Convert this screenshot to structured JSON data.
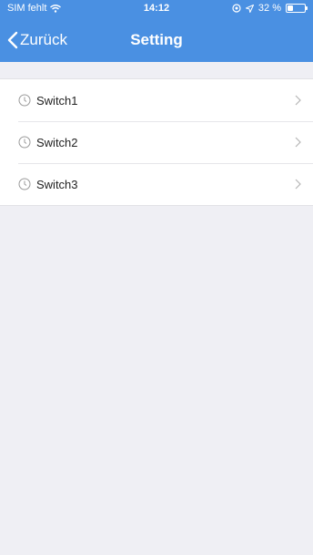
{
  "status_bar": {
    "carrier": "SIM fehlt",
    "time": "14:12",
    "battery": "32 %",
    "battery_level": 0.32
  },
  "nav": {
    "back_label": "Zurück",
    "title": "Setting"
  },
  "list": {
    "items": [
      {
        "label": "Switch1",
        "icon": "clock-icon"
      },
      {
        "label": "Switch2",
        "icon": "clock-icon"
      },
      {
        "label": "Switch3",
        "icon": "clock-icon"
      }
    ]
  },
  "colors": {
    "header": "#4a90e2",
    "background": "#efeff4"
  }
}
